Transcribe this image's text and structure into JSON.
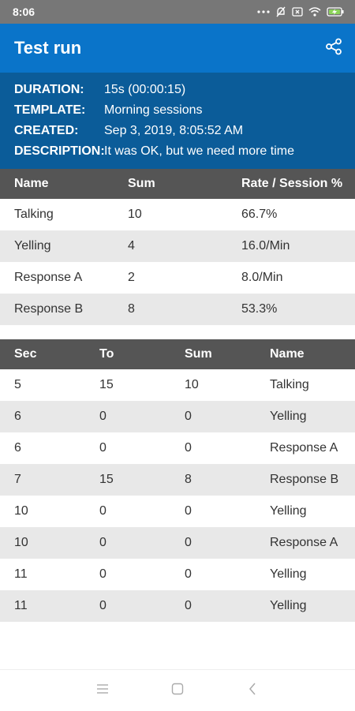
{
  "status_bar": {
    "time": "8:06"
  },
  "app_bar": {
    "title": "Test run"
  },
  "info": {
    "rows": [
      {
        "label": "DURATION:",
        "value": "15s (00:00:15)"
      },
      {
        "label": "TEMPLATE:",
        "value": "Morning sessions"
      },
      {
        "label": "CREATED:",
        "value": "Sep 3, 2019, 8:05:52 AM"
      },
      {
        "label": "DESCRIPTION:",
        "value": "It was OK, but we need more time"
      }
    ]
  },
  "summary_table": {
    "headers": [
      "Name",
      "Sum",
      "Rate / Session %"
    ],
    "rows": [
      [
        "Talking",
        "10",
        "66.7%"
      ],
      [
        "Yelling",
        "4",
        "16.0/Min"
      ],
      [
        "Response A",
        "2",
        "8.0/Min"
      ],
      [
        "Response B",
        "8",
        "53.3%"
      ]
    ]
  },
  "events_table": {
    "headers": [
      "Sec",
      "To",
      "Sum",
      "Name"
    ],
    "rows": [
      [
        "5",
        "15",
        "10",
        "Talking"
      ],
      [
        "6",
        "0",
        "0",
        "Yelling"
      ],
      [
        "6",
        "0",
        "0",
        "Response A"
      ],
      [
        "7",
        "15",
        "8",
        "Response B"
      ],
      [
        "10",
        "0",
        "0",
        "Yelling"
      ],
      [
        "10",
        "0",
        "0",
        "Response A"
      ],
      [
        "11",
        "0",
        "0",
        "Yelling"
      ],
      [
        "11",
        "0",
        "0",
        "Yelling"
      ]
    ]
  },
  "icons": {
    "share": "share-icon",
    "nav_menu": "menu-icon",
    "nav_home": "home-square-icon",
    "nav_back": "back-chevron-icon"
  },
  "colors": {
    "app_bar": "#0a74c9",
    "info_panel": "#0b5c99",
    "table_header": "#555555",
    "row_alt": "#e8e8e8",
    "status_bar": "#777777"
  }
}
